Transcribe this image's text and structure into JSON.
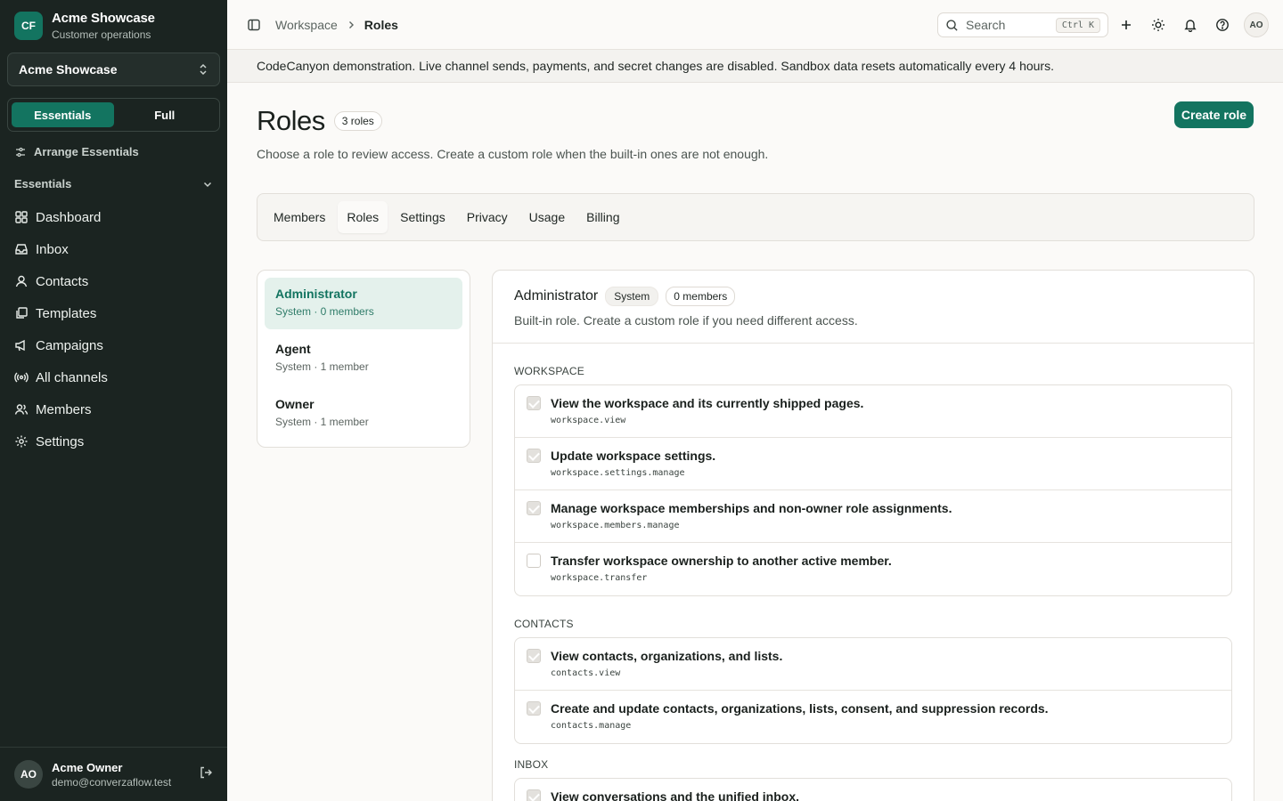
{
  "brand": {
    "logo": "CF",
    "name": "Acme Showcase",
    "subtitle": "Customer operations"
  },
  "workspace_switcher": {
    "label": "Acme Showcase"
  },
  "mode": {
    "options": [
      "Essentials",
      "Full"
    ],
    "selected": "Essentials"
  },
  "sidebar": {
    "arrange_label": "Arrange Essentials",
    "section_label": "Essentials",
    "items": [
      {
        "label": "Dashboard",
        "icon": "dashboard-icon"
      },
      {
        "label": "Inbox",
        "icon": "inbox-icon"
      },
      {
        "label": "Contacts",
        "icon": "contacts-icon"
      },
      {
        "label": "Templates",
        "icon": "templates-icon"
      },
      {
        "label": "Campaigns",
        "icon": "megaphone-icon"
      },
      {
        "label": "All channels",
        "icon": "broadcast-icon"
      },
      {
        "label": "Members",
        "icon": "members-icon"
      },
      {
        "label": "Settings",
        "icon": "gear-icon"
      }
    ]
  },
  "user": {
    "initials": "AO",
    "name": "Acme Owner",
    "email": "demo@converzaflow.test"
  },
  "topbar": {
    "breadcrumb": [
      "Workspace",
      "Roles"
    ],
    "search_placeholder": "Search",
    "search_shortcut": "Ctrl K",
    "avatar_initials": "AO"
  },
  "banner": "CodeCanyon demonstration. Live channel sends, payments, and secret changes are disabled. Sandbox data resets automatically every 4 hours.",
  "page": {
    "title": "Roles",
    "count_badge": "3 roles",
    "subtitle": "Choose a role to review access. Create a custom role when the built-in ones are not enough.",
    "create_button": "Create role"
  },
  "tabs": {
    "items": [
      "Members",
      "Roles",
      "Settings",
      "Privacy",
      "Usage",
      "Billing"
    ],
    "active": "Roles"
  },
  "roles": [
    {
      "name": "Administrator",
      "meta": "System · 0 members",
      "selected": true
    },
    {
      "name": "Agent",
      "meta": "System · 1 member",
      "selected": false
    },
    {
      "name": "Owner",
      "meta": "System · 1 member",
      "selected": false
    }
  ],
  "detail": {
    "title": "Administrator",
    "type_badge": "System",
    "members_badge": "0 members",
    "description": "Built-in role. Create a custom role if you need different access.",
    "groups": [
      {
        "title": "Workspace",
        "permissions": [
          {
            "label": "View the workspace and its currently shipped pages.",
            "code": "workspace.view",
            "checked": true
          },
          {
            "label": "Update workspace settings.",
            "code": "workspace.settings.manage",
            "checked": true
          },
          {
            "label": "Manage workspace memberships and non-owner role assignments.",
            "code": "workspace.members.manage",
            "checked": true
          },
          {
            "label": "Transfer workspace ownership to another active member.",
            "code": "workspace.transfer",
            "checked": false
          }
        ]
      },
      {
        "title": "Contacts",
        "permissions": [
          {
            "label": "View contacts, organizations, and lists.",
            "code": "contacts.view",
            "checked": true
          },
          {
            "label": "Create and update contacts, organizations, lists, consent, and suppression records.",
            "code": "contacts.manage",
            "checked": true
          }
        ]
      },
      {
        "title": "Inbox",
        "permissions": [
          {
            "label": "View conversations and the unified inbox.",
            "code": "",
            "checked": true
          }
        ]
      }
    ]
  },
  "colors": {
    "accent": "#137460",
    "sidebar_bg": "#1b2421",
    "page_bg": "#fbfaf8"
  }
}
